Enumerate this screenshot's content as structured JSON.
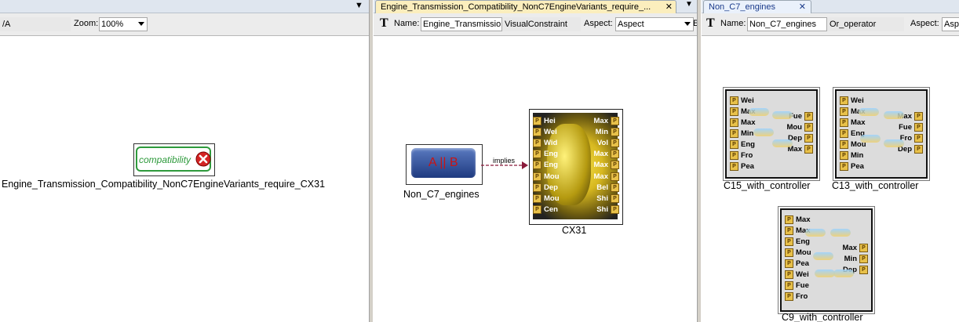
{
  "left_pane": {
    "collapse_arrow": "▼",
    "aspect_value": "/A",
    "zoom_label": "Zoom:",
    "zoom_value": "100%",
    "badge_text": "compatibility",
    "caption": "Engine_Transmission_Compatibility_NonC7EngineVariants_require_CX31"
  },
  "middle_pane": {
    "tab_title": "Engine_Transmission_Compatibility_NonC7EngineVariants_require_...",
    "tab_close": "✕",
    "tab_menu": "▼",
    "name_label": "Name:",
    "name_value": "Engine_Transmission",
    "kind_value": "VisualConstraint",
    "aspect_label": "Aspect:",
    "aspect_value": "Aspect",
    "extra_label": "E",
    "or_block_text": "A || B",
    "or_block_caption": "Non_C7_engines",
    "connector_label": "implies",
    "cx31_caption": "CX31",
    "cx31_left_ports": [
      "Hei",
      "Wei",
      "Wid",
      "Eng",
      "Eng",
      "Mou",
      "Dep",
      "Mou",
      "Cen"
    ],
    "cx31_right_ports": [
      "Max",
      "Min",
      "Vol",
      "Max",
      "Max",
      "Max",
      "Bel",
      "Shi",
      "Shi"
    ]
  },
  "right_pane": {
    "tab_title": "Non_C7_engines",
    "tab_close": "✕",
    "name_label": "Name:",
    "name_value": "Non_C7_engines",
    "kind_value": "Or_operator",
    "aspect_label": "Aspect:",
    "aspect_value": "Asp",
    "models": [
      {
        "caption": "C15_with_controller",
        "left_ports": [
          "Wei",
          "Max",
          "Max",
          "Min",
          "Eng",
          "Fro",
          "Pea"
        ],
        "right_ports": [
          "Fue",
          "Mou",
          "Dep",
          "Max"
        ]
      },
      {
        "caption": "C13_with_controller",
        "left_ports": [
          "Wei",
          "Max",
          "Max",
          "Eng",
          "Mou",
          "Min",
          "Pea"
        ],
        "right_ports": [
          "Max",
          "Fue",
          "Fro",
          "Dep"
        ]
      },
      {
        "caption": "C9_with_controller",
        "left_ports": [
          "Max",
          "Max",
          "Eng",
          "Mou",
          "Pea",
          "Wei",
          "Fue",
          "Fro"
        ],
        "right_ports": [
          "Max",
          "Min",
          "Dep"
        ]
      }
    ]
  },
  "port_glyph": "P",
  "colors": {
    "tab_active": "#fbeebd",
    "accent_green": "#2e9a3c",
    "error_red": "#d42424",
    "connector": "#8a1a3a",
    "or_block": "#2c4a8c"
  }
}
